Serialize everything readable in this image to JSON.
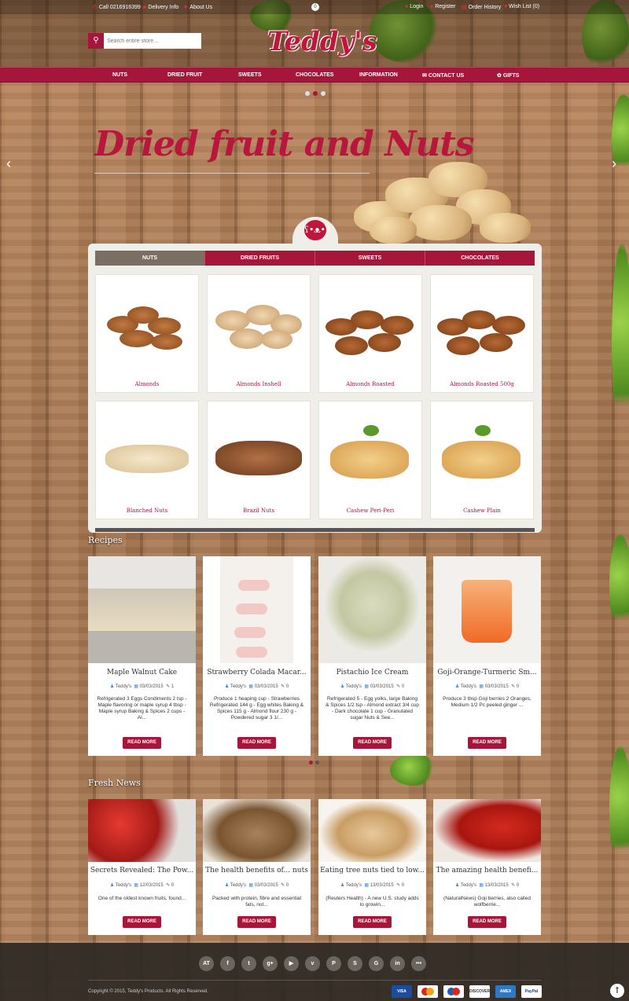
{
  "topbar": {
    "call": "Call 0216916399",
    "delivery": "Delivery Info",
    "about": "About Us",
    "cart_count": "0",
    "login": "Login",
    "register": "Register",
    "order_history": "Order History",
    "wishlist": "Wish List (0)"
  },
  "search": {
    "placeholder": "Search entire store..."
  },
  "logo": {
    "text": "Teddy's"
  },
  "nav": [
    "NUTS",
    "DRIED FRUIT",
    "SWEETS",
    "CHOCOLATES",
    "INFORMATION",
    "CONTACT US",
    "GIFTS"
  ],
  "slider": {
    "title": "Dried fruit and Nuts",
    "active_dot": 2
  },
  "tabs": [
    "NUTS",
    "DRIED FRUITS",
    "SWEETS",
    "CHOCOLATES"
  ],
  "products": [
    "Almonds",
    "Almonds Inshell",
    "Almonds Roasted",
    "Almonds Roasted 500g",
    "Blanched Nuts",
    "Brazil Nuts",
    "Cashew Peri-Peri",
    "Cashew Plain"
  ],
  "recipes": {
    "title": "Recipes",
    "items": [
      {
        "title": "Maple Walnut Cake",
        "author": "Teddy's",
        "date": "03/03/2015",
        "comments": "1",
        "desc": "Refrigerated    3 Eggs     Condiments 2 tsp - Maple flavoring or maple syrup 4 tbsp - Maple syrup     Baking & Spices     2 cups - Al..."
      },
      {
        "title": "Strawberry Colada Macar...",
        "author": "Teddy's",
        "date": "03/03/2015",
        "comments": "0",
        "desc": "Produce 1 heaping cup - Strawberries Refrigerated 144 g - Egg whites Baking & Spices 115 g - Almond flour 230 g - Powdered sugar 3 1/..."
      },
      {
        "title": "Pistachio Ice Cream",
        "author": "Teddy's",
        "date": "03/03/2015",
        "comments": "0",
        "desc": "Refrigerated 5 - Egg yolks, large Baking & Spices 1/2 tsp - Almond extract 3/4 cup - Dark chocolate 1 cup - Granulated sugar     Nuts & See..."
      },
      {
        "title": "Goji-Orange-Turmeric Sm...",
        "author": "Teddy's",
        "date": "03/03/2015",
        "comments": "0",
        "desc": "Produce 3 tbsp Goji berries 2 Oranges, Medium 1/2 Pc peeled ginger ..."
      }
    ],
    "button": "READ MORE"
  },
  "news": {
    "title": "Fresh News",
    "items": [
      {
        "title": "Secrets Revealed: The Pow...",
        "author": "Teddy's",
        "date": "12/03/2015",
        "comments": "0",
        "desc": "One of the oldest known fruits, found..."
      },
      {
        "title": "The health benefits of... nuts",
        "author": "Teddy's",
        "date": "03/03/2015",
        "comments": "0",
        "desc": "Packed with protein, fibre and essential fats, nut..."
      },
      {
        "title": "Eating tree nuts tied to low...",
        "author": "Teddy's",
        "date": "13/03/2015",
        "comments": "0",
        "desc": "(Reuters Health) - A new U.S. study adds to growin..."
      },
      {
        "title": "The amazing health benefi...",
        "author": "Teddy's",
        "date": "13/03/2015",
        "comments": "0",
        "desc": "(NaturalNews) Goji berries, also called wolfberrie..."
      }
    ],
    "button": "READ MORE"
  },
  "footer": {
    "social": [
      "AT",
      "f",
      "t",
      "g+",
      "▶",
      "v",
      "P",
      "S",
      "G",
      "in",
      "•••"
    ],
    "copyright": "Copyright © 2015, Teddy's Products. All Rights Reserved.",
    "payments": [
      "VISA Electron",
      "",
      "",
      "DISCOVER",
      "AMEX",
      "PayPal"
    ]
  },
  "colors": {
    "brand": "#a6163b",
    "active_tab": "#7b6e62"
  }
}
